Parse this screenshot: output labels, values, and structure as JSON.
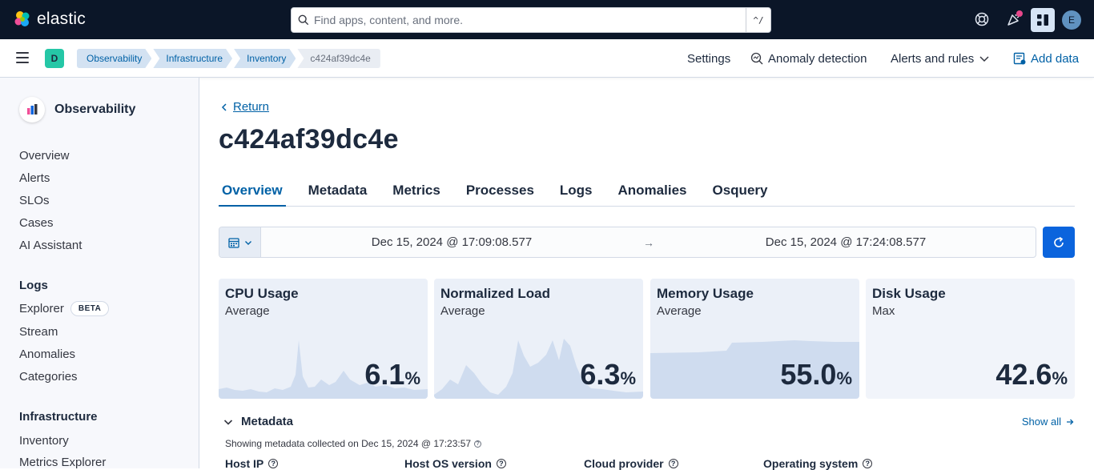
{
  "header": {
    "brand": "elastic",
    "search_placeholder": "Find apps, content, and more.",
    "search_shortcut": "^/",
    "avatar_initial": "E",
    "colors": {
      "bg": "#0b1628",
      "accent": "#0b64dd",
      "news_dot": "#e7478b"
    }
  },
  "subbar": {
    "space_initial": "D",
    "breadcrumbs": [
      "Observability",
      "Infrastructure",
      "Inventory",
      "c424af39dc4e"
    ],
    "settings": "Settings",
    "anomaly_detection": "Anomaly detection",
    "alerts_and_rules": "Alerts and rules",
    "add_data": "Add data"
  },
  "sidebar": {
    "title": "Observability",
    "items": [
      "Overview",
      "Alerts",
      "SLOs",
      "Cases",
      "AI Assistant"
    ],
    "logs_group": "Logs",
    "logs_items": [
      "Explorer",
      "Stream",
      "Anomalies",
      "Categories"
    ],
    "beta_badge": "BETA",
    "infra_group": "Infrastructure",
    "infra_items": [
      "Inventory",
      "Metrics Explorer"
    ]
  },
  "main": {
    "return_label": "Return",
    "title": "c424af39dc4e",
    "tabs": [
      "Overview",
      "Metadata",
      "Metrics",
      "Processes",
      "Logs",
      "Anomalies",
      "Osquery"
    ],
    "active_tab": "Overview",
    "date_start": "Dec 15, 2024 @ 17:09:08.577",
    "date_end": "Dec 15, 2024 @ 17:24:08.577",
    "date_arrow": "→",
    "kpis": [
      {
        "title": "CPU Usage",
        "sub": "Average",
        "value": "6.1",
        "unit": "%"
      },
      {
        "title": "Normalized Load",
        "sub": "Average",
        "value": "6.3",
        "unit": "%"
      },
      {
        "title": "Memory Usage",
        "sub": "Average",
        "value": "55.0",
        "unit": "%"
      },
      {
        "title": "Disk Usage",
        "sub": "Max",
        "value": "42.6",
        "unit": "%"
      }
    ],
    "metadata": {
      "title": "Metadata",
      "show_all": "Show all",
      "note": "Showing metadata collected on Dec 15, 2024 @ 17:23:57",
      "columns": [
        "Host IP",
        "Host OS version",
        "Cloud provider",
        "Operating system"
      ]
    }
  }
}
